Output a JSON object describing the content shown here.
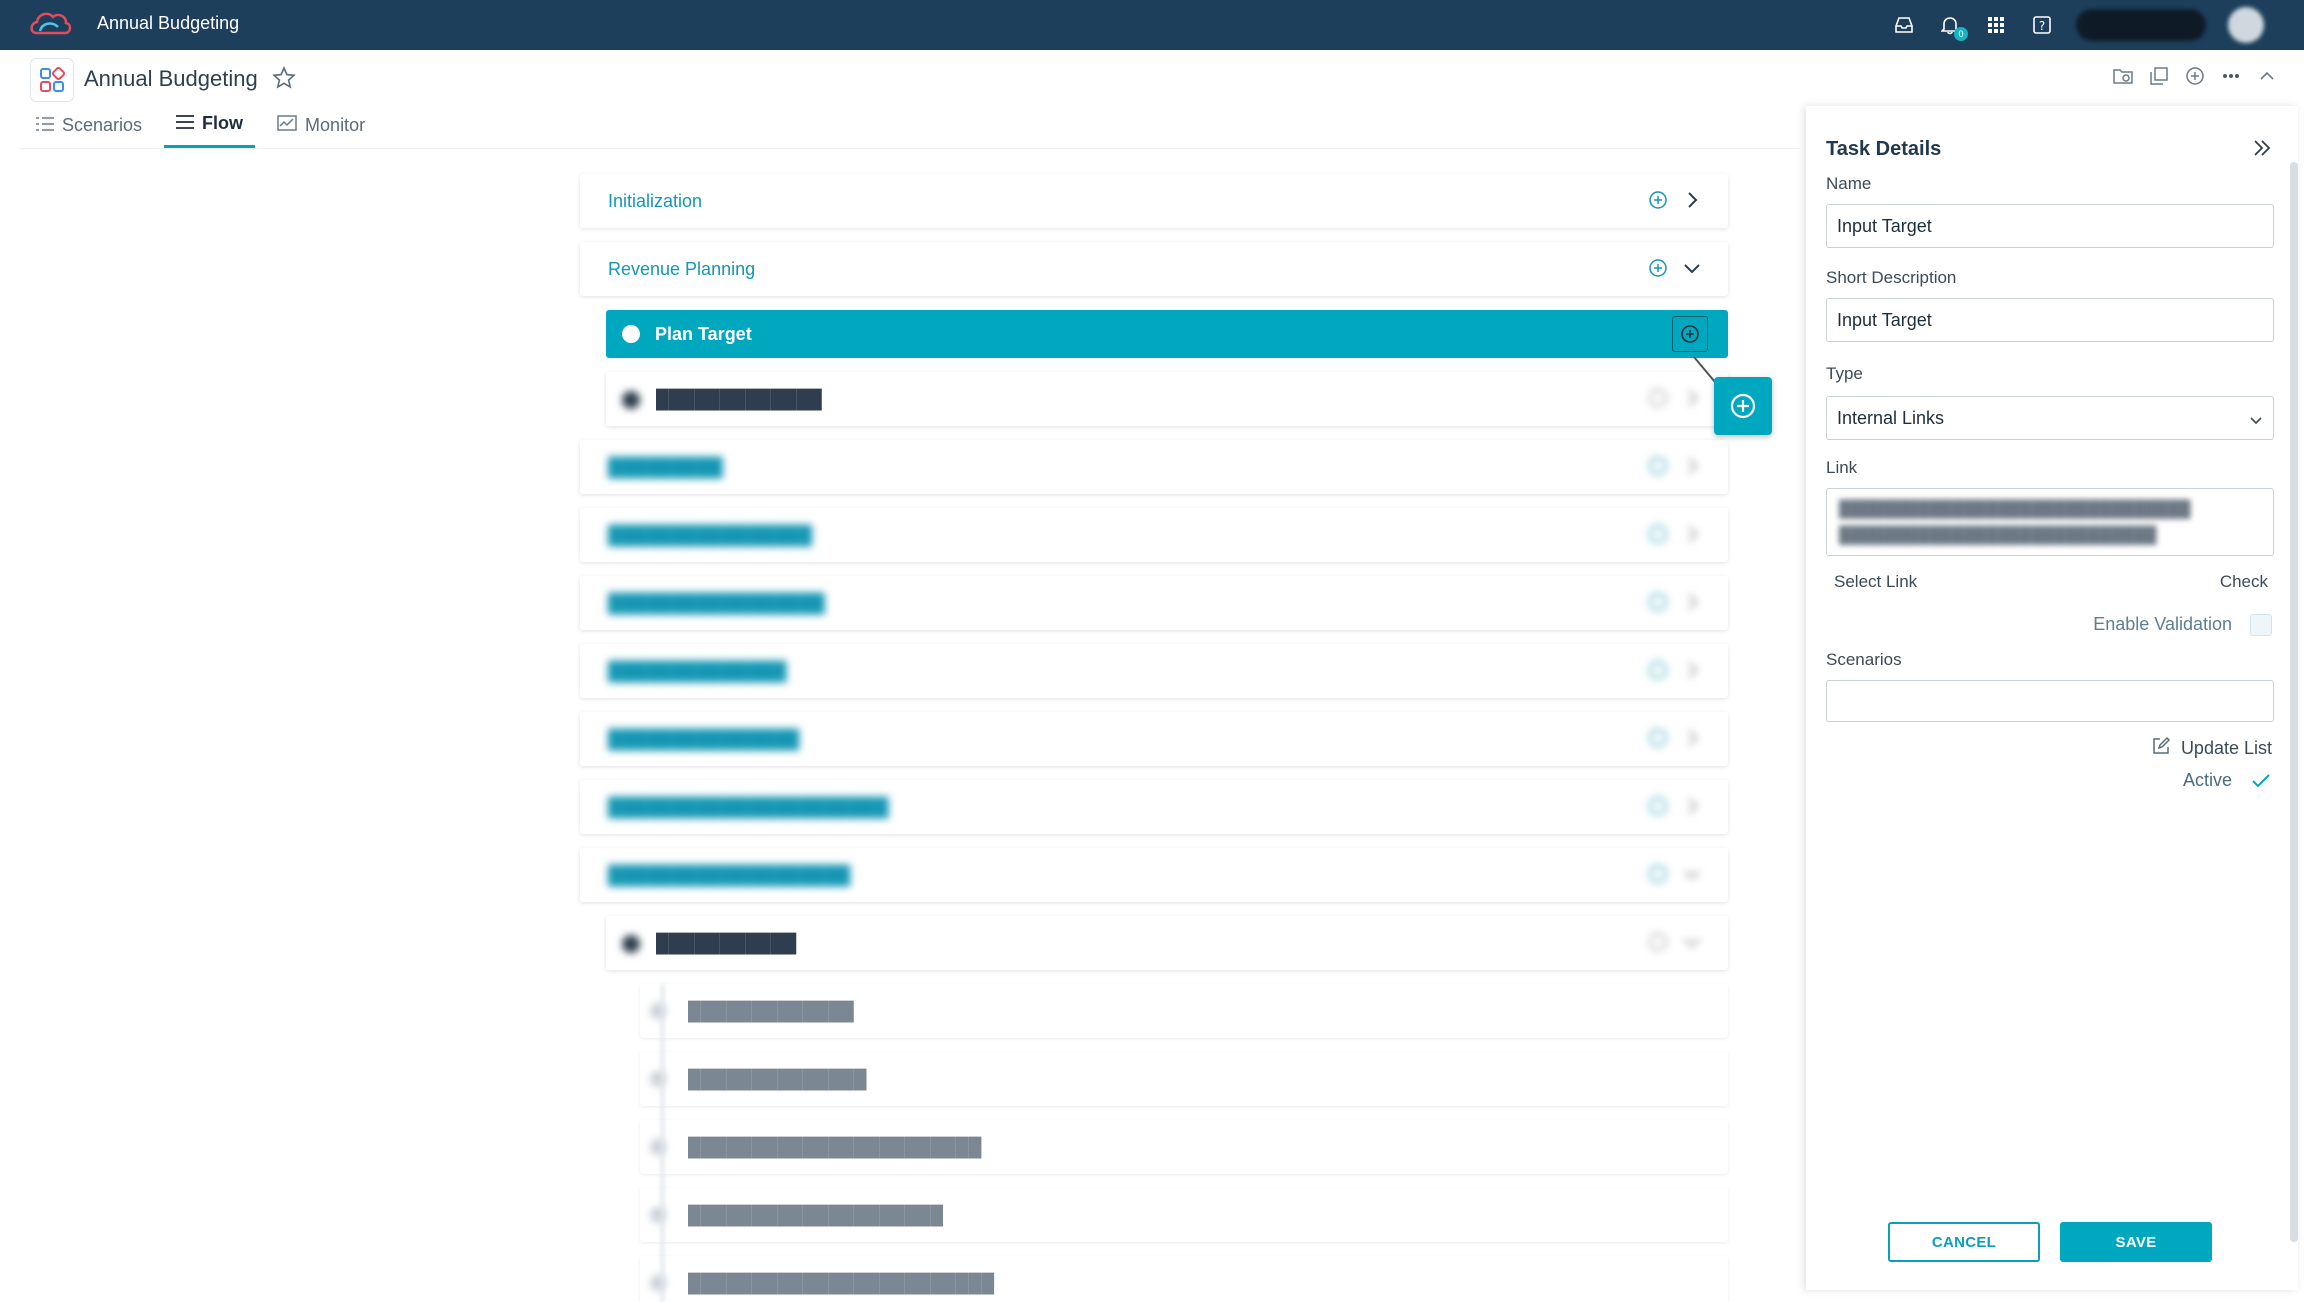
{
  "topbar": {
    "app_title": "Annual Budgeting",
    "notification_count": "0"
  },
  "header": {
    "page_title": "Annual Budgeting"
  },
  "tabs": [
    {
      "label": "Scenarios",
      "active": false
    },
    {
      "label": "Flow",
      "active": true
    },
    {
      "label": "Monitor",
      "active": false
    }
  ],
  "flow": {
    "items": [
      {
        "label": "Initialization"
      },
      {
        "label": "Revenue Planning"
      },
      {
        "label": "Plan Target"
      }
    ]
  },
  "panel": {
    "title": "Task Details",
    "name_label": "Name",
    "name_value": "Input Target",
    "short_desc_label": "Short Description",
    "short_desc_value": "Input Target",
    "type_label": "Type",
    "type_value": "Internal Links",
    "link_label": "Link",
    "select_link": "Select Link",
    "check": "Check",
    "enable_validation": "Enable Validation",
    "scenarios_label": "Scenarios",
    "update_list": "Update List",
    "active_label": "Active",
    "cancel": "CANCEL",
    "save": "SAVE"
  },
  "colors": {
    "topbar": "#1d3f5c",
    "accent": "#00a8bf",
    "link_text": "#1597b4"
  }
}
